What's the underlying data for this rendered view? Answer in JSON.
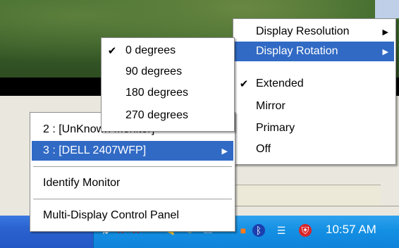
{
  "rotation_menu": {
    "items": [
      {
        "label": "0 degrees",
        "checked": true
      },
      {
        "label": "90 degrees",
        "checked": false
      },
      {
        "label": "180 degrees",
        "checked": false
      },
      {
        "label": "270 degrees",
        "checked": false
      }
    ]
  },
  "display_menu": {
    "resolution_label": "Display Resolution",
    "rotation_label": "Display Rotation",
    "modes": [
      {
        "label": "Extended",
        "checked": true
      },
      {
        "label": "Mirror",
        "checked": false
      },
      {
        "label": "Primary",
        "checked": false
      },
      {
        "label": "Off",
        "checked": false
      }
    ]
  },
  "monitor_menu": {
    "monitor_2": "2 : [UnKnown Monitor]",
    "monitor_3": "3 : [DELL 2407WFP]",
    "identify": "Identify Monitor",
    "control_panel": "Multi-Display Control Panel"
  },
  "glyphs": {
    "check": "✔",
    "arrow": "▶"
  },
  "taskbar": {
    "clock": "10:57 AM",
    "tray_icons": [
      {
        "name": "network-icon",
        "glyph": "⇅"
      },
      {
        "name": "disconnected-network-icon",
        "glyph": "✕"
      },
      {
        "name": "disconnected-network-icon-2",
        "glyph": "✕"
      },
      {
        "name": "volume-icon",
        "glyph": "◀"
      },
      {
        "name": "pen-icon",
        "glyph": "✎"
      },
      {
        "name": "display-icon",
        "glyph": "▭"
      },
      {
        "name": "app-icon",
        "glyph": "■"
      },
      {
        "name": "bluetooth-icon",
        "glyph": "ᛒ"
      },
      {
        "name": "wireless-icon",
        "glyph": "☰"
      },
      {
        "name": "security-shield-icon",
        "glyph": "⛨"
      }
    ]
  },
  "colors": {
    "selection": "#316ac5",
    "taskbar": "#2457c6",
    "tray": "#1490e3"
  }
}
